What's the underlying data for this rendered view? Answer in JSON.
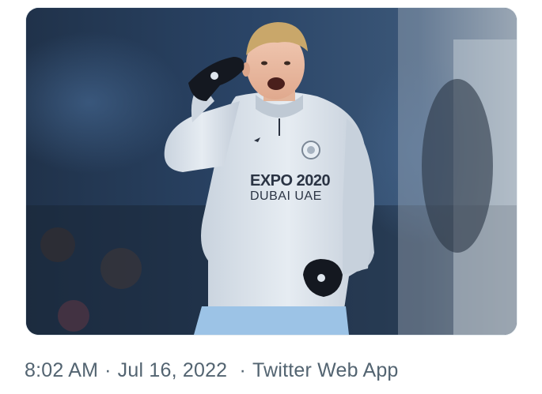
{
  "tweet": {
    "media": {
      "alt": "Footballer in light blue training top gesturing while shouting",
      "shirt_text_line1": "EXPO 2020",
      "shirt_text_line2": "DUBAI UAE"
    },
    "meta": {
      "time": "8:02 AM",
      "separator": "·",
      "date": "Jul 16, 2022",
      "source": "Twitter Web App"
    }
  },
  "colors": {
    "meta_text": "#536471",
    "border": "#e6ecf0",
    "stadium_bg": "#1d2a3a",
    "shirt": "#d6dde6",
    "shorts": "#9cc3e6"
  }
}
